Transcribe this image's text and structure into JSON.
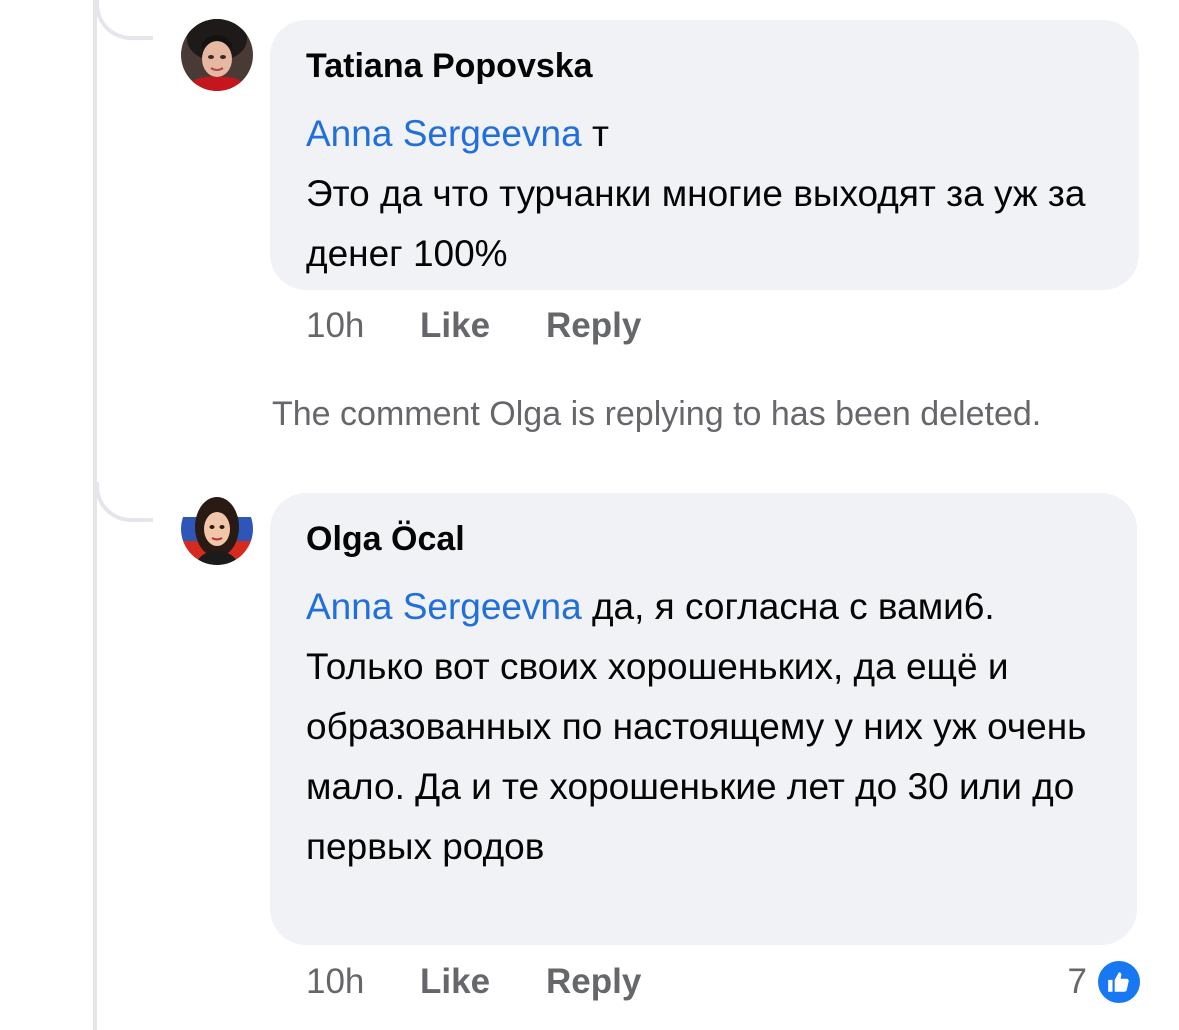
{
  "comments": [
    {
      "author": "Tatiana Popovska",
      "mention": "Anna Sergeevna",
      "line1_suffix": " т",
      "body": "Это да что турчанки многие выходят за уж за денег 100%",
      "time": "10h",
      "like_label": "Like",
      "reply_label": "Reply"
    },
    {
      "author": "Olga Öcal",
      "mention": "Anna Sergeevna",
      "body": " да, я согласна с вами6. Только вот своих хорошеньких, да ещё и образованных по настоящему у них уж очень мало. Да и те хорошенькие лет до 30 или до первых родов",
      "time": "10h",
      "like_label": "Like",
      "reply_label": "Reply",
      "reaction_count": "7",
      "reaction_icon": "thumbs-up-icon"
    }
  ],
  "deleted_note": "The comment Olga is replying to has been deleted.",
  "colors": {
    "bubble": "#f0f2f5",
    "mention": "#216fdb",
    "muted": "#65676b",
    "like_blue": "#1877f2"
  }
}
